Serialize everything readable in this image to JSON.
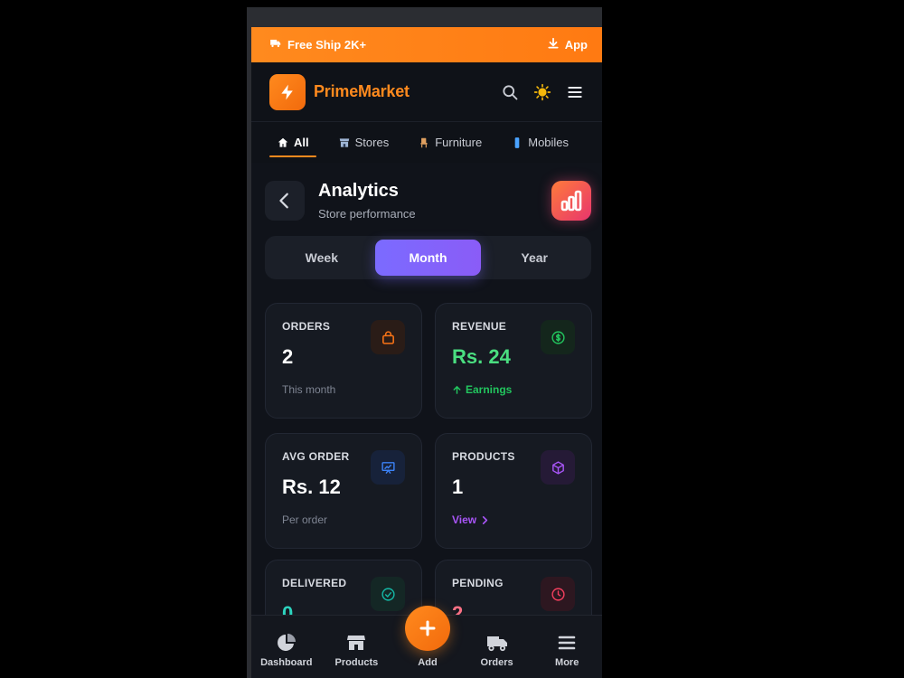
{
  "promo": {
    "left_text": "Free Ship 2K+",
    "right_text": "App"
  },
  "header": {
    "brand": "PrimeMarket",
    "accent": "#ff8a1e"
  },
  "categories": [
    {
      "label": "All",
      "icon": "home-icon",
      "active": true
    },
    {
      "label": "Stores",
      "icon": "store-icon",
      "active": false
    },
    {
      "label": "Furniture",
      "icon": "chair-icon",
      "active": false
    },
    {
      "label": "Mobiles",
      "icon": "phone-icon",
      "active": false
    }
  ],
  "page": {
    "title": "Analytics",
    "subtitle": "Store performance"
  },
  "period": {
    "options": [
      "Week",
      "Month",
      "Year"
    ],
    "selected": "Month"
  },
  "stats": {
    "orders": {
      "label": "ORDERS",
      "value": "2",
      "note": "This month",
      "color": "#f97316"
    },
    "revenue": {
      "label": "REVENUE",
      "value": "Rs. 24",
      "note": "Earnings",
      "color": "#22c55e"
    },
    "avg_order": {
      "label": "AVG ORDER",
      "value": "Rs. 12",
      "note": "Per order",
      "color": "#3b82f6"
    },
    "products": {
      "label": "PRODUCTS",
      "value": "1",
      "note": "View",
      "color": "#a855f7"
    },
    "delivered": {
      "label": "DELIVERED",
      "value": "0",
      "color": "#14b8a6"
    },
    "pending": {
      "label": "PENDING",
      "value": "2",
      "color": "#f43f5e"
    }
  },
  "nav": {
    "dashboard": "Dashboard",
    "products": "Products",
    "add": "Add",
    "orders": "Orders",
    "more": "More"
  }
}
